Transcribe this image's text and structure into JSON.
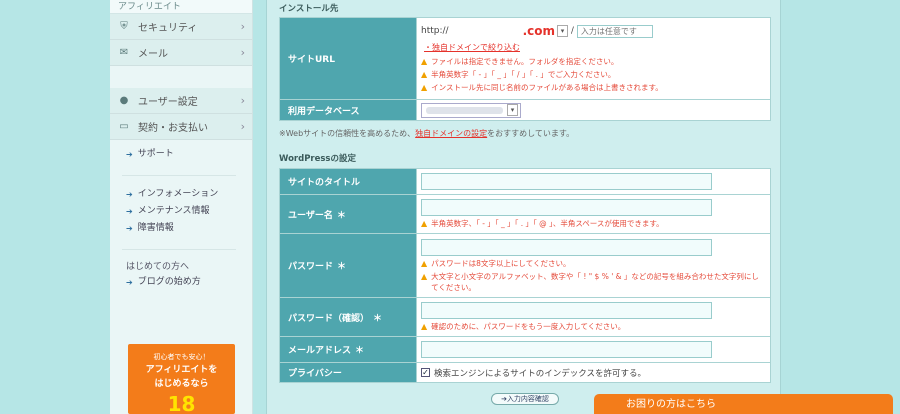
{
  "sidebar": {
    "top_label": "アフィリエイト",
    "menu": [
      {
        "icon": "shield-icon",
        "glyph": "⛨",
        "label": "セキュリティ"
      },
      {
        "icon": "mail-icon",
        "glyph": "✉",
        "label": "メール"
      },
      {
        "icon": "user-icon",
        "glyph": "👤",
        "label": "ユーザー設定"
      },
      {
        "icon": "card-icon",
        "glyph": "▭",
        "label": "契約・お支払い"
      }
    ],
    "support": "サポート",
    "info_links": [
      "インフォメーション",
      "メンテナンス情報",
      "障害情報"
    ],
    "beginner_label": "はじめての方へ",
    "blog_link": "ブログの始め方",
    "promo": {
      "small": "初心者でも安心！",
      "big_line1": "アフィリエイトを",
      "big_line2": "はじめるなら",
      "number": "18"
    }
  },
  "install": {
    "section_title": "インストール先",
    "site_url_label": "サイトURL",
    "url_prefix": "http://",
    "url_domain": ".com",
    "slash": "/",
    "optional_placeholder": "入力は任意です",
    "own_domain_link": "・独自ドメインで絞り込む",
    "warnings": [
      "ファイルは指定できません。フォルダを指定ください。",
      "半角英数字「 - 」「 _ 」「 / 」「 . 」でご入力ください。",
      "インストール先に同じ名前のファイルがある場合は上書きされます。"
    ],
    "db_label": "利用データベース",
    "note_prefix": "※Webサイトの信頼性を高めるため、",
    "note_link": "独自ドメインの設定",
    "note_suffix": "をおすすめしています。"
  },
  "wordpress": {
    "section_title": "WordPressの設定",
    "site_title_label": "サイトのタイトル",
    "username_label": "ユーザー名",
    "username_warning": "半角英数字、「 - 」「 _ 」「 . 」「 @ 」、半角スペースが使用できます。",
    "password_label": "パスワード",
    "password_warnings": [
      "パスワードは8文字以上にしてください。",
      "大文字と小文字のアルファベット、数字や「 ! \" $ % ' & 」などの記号を組み合わせた文字列にしてください。"
    ],
    "password_confirm_label": "パスワード（確認）",
    "password_confirm_warning": "確認のために、パスワードをもう一度入力してください。",
    "email_label": "メールアドレス",
    "privacy_label": "プライバシー",
    "privacy_checkbox": "検索エンジンによるサイトのインデックスを許可する。",
    "required_mark": "＊"
  },
  "confirm_button": "入力内容確認",
  "help_bar": "お困りの方はこちら",
  "colors": {
    "header_teal": "#4fa6ae",
    "accent_orange": "#f37c1a",
    "warning_red": "#e54b3b"
  }
}
